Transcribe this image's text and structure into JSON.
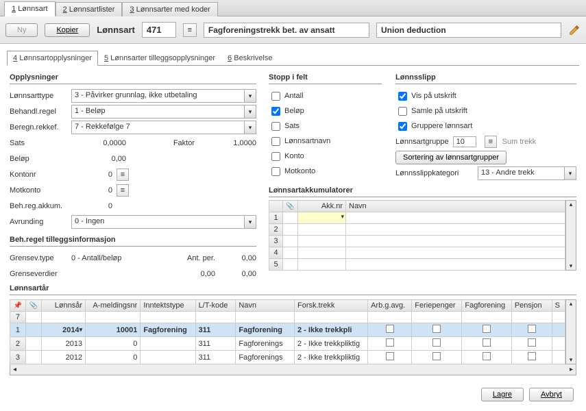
{
  "top_tabs": [
    {
      "num": "1",
      "label": "Lønnsart"
    },
    {
      "num": "2",
      "label": "Lønnsartlister"
    },
    {
      "num": "3",
      "label": "Lønnsarter med koder"
    }
  ],
  "active_top_tab": 0,
  "buttons": {
    "ny": "Ny",
    "kopier": "Kopier",
    "sort_grupper": "Sortering av lønnsartgrupper",
    "lagre": "Lagre",
    "avbryt": "Avbryt"
  },
  "header": {
    "label": "Lønnsart",
    "id": "471",
    "desc_no": "Fagforeningstrekk bet. av ansatt",
    "desc_en": "Union deduction"
  },
  "sub_tabs": [
    {
      "num": "4",
      "label": "Lønnsartopplysninger"
    },
    {
      "num": "5",
      "label": "Lønnsarter tilleggsopplysninger"
    },
    {
      "num": "6",
      "label": "Beskrivelse"
    }
  ],
  "active_sub_tab": 0,
  "opplysninger": {
    "title": "Opplysninger",
    "lonnsarttype_lbl": "Lønnsarttype",
    "lonnsarttype": "3 - Påvirker grunnlag, ikke utbetaling",
    "behandl_lbl": "Behandl.regel",
    "behandl": "1 - Beløp",
    "beregn_lbl": "Beregn.rekkef.",
    "beregn": "7 - Rekkefølge 7",
    "sats_lbl": "Sats",
    "sats": "0,0000",
    "faktor_lbl": "Faktor",
    "faktor": "1,0000",
    "belop_lbl": "Beløp",
    "belop": "0,00",
    "kontonr_lbl": "Kontonr",
    "kontonr": "0",
    "motkonto_lbl": "Motkonto",
    "motkonto": "0",
    "behakkum_lbl": "Beh.reg.akkum.",
    "behakkum": "0",
    "avrunding_lbl": "Avrunding",
    "avrunding": "0 - Ingen"
  },
  "behregel": {
    "title": "Beh.regel tilleggsinformasjon",
    "grensev_lbl": "Grensev.type",
    "grensev": "0 - Antall/beløp",
    "antper_lbl": "Ant. per.",
    "antper": "0,00",
    "grenseverdier_lbl": "Grenseverdier",
    "grenseverdier1": "0,00",
    "grenseverdier2": "0,00"
  },
  "stopp": {
    "title": "Stopp i felt",
    "antall": "Antall",
    "belop": "Beløp",
    "sats": "Sats",
    "lnavn": "Lønnsartnavn",
    "konto": "Konto",
    "motkonto": "Motkonto"
  },
  "slipp": {
    "title": "Lønnsslipp",
    "vis": "Vis på utskrift",
    "samle": "Samle på utskrift",
    "grupp": "Gruppere lønnsart",
    "lartgr_lbl": "Lønnsartgruppe",
    "lartgr_val": "10",
    "sumtrekk": "Sum trekk",
    "kategori_lbl": "Lønnsslippkategori",
    "kategori": "13 - Andre trekk"
  },
  "akk": {
    "title": "Lønnsartakkumulatorer",
    "cols": {
      "attach": "",
      "akknr": "Akk.nr",
      "navn": "Navn"
    },
    "rows": 5
  },
  "lonnsartar": {
    "title": "Lønnsartår",
    "cols": [
      "",
      "",
      "Lønnsår",
      "A-meldingsnr",
      "Inntektstype",
      "L/T-kode",
      "Navn",
      "Forsk.trekk",
      "Arb.g.avg.",
      "Feriepenger",
      "Fagforening",
      "Pensjon",
      "S"
    ],
    "rows": [
      {
        "n": "7",
        "ar": "",
        "am": "",
        "it": "",
        "lt": "",
        "navn": "",
        "ft": "",
        "chk": false
      },
      {
        "n": "1",
        "ar": "2014",
        "am": "10001",
        "it": "Fagforening",
        "lt": "311",
        "navn": "Fagforening",
        "ft": "2 - Ikke trekkpli",
        "chk": false,
        "selected": true,
        "dropdown": true
      },
      {
        "n": "2",
        "ar": "2013",
        "am": "0",
        "it": "",
        "lt": "311",
        "navn": "Fagforenings",
        "ft": "2 - Ikke trekkpliktig",
        "chk": false
      },
      {
        "n": "3",
        "ar": "2012",
        "am": "0",
        "it": "",
        "lt": "311",
        "navn": "Fagforenings",
        "ft": "2 - Ikke trekkpliktig",
        "chk": false
      }
    ]
  }
}
